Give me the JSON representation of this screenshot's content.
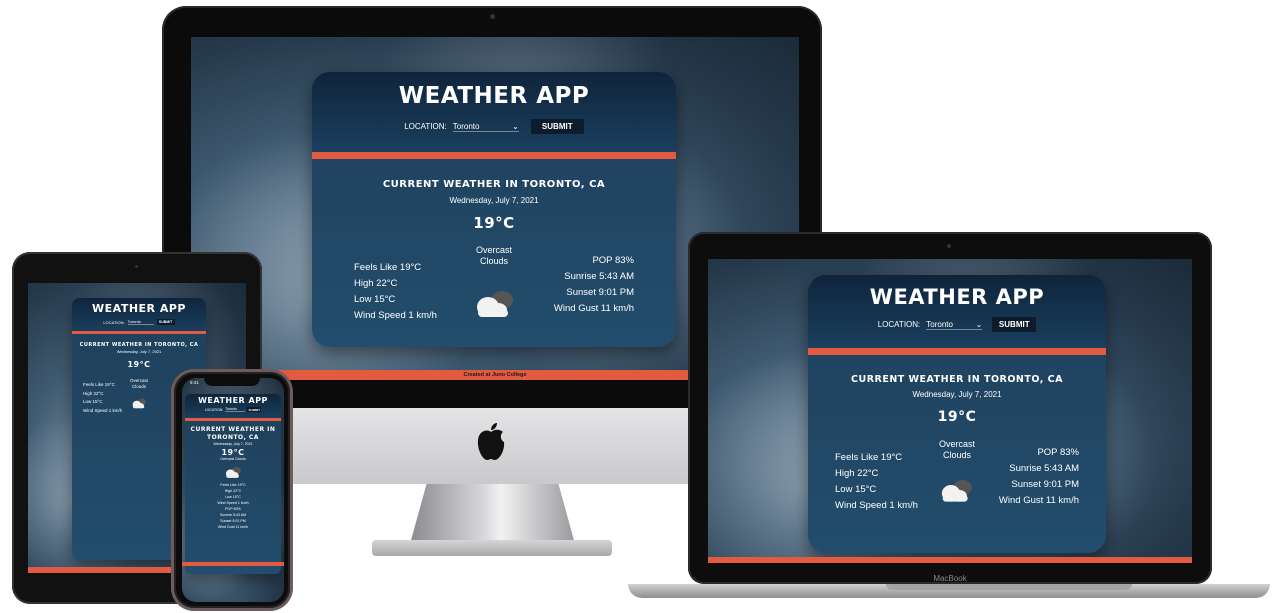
{
  "app": {
    "title": "WEATHER APP",
    "location_label": "LOCATION:",
    "location_value": "Toronto",
    "submit_label": "SUBMIT",
    "heading": "CURRENT WEATHER IN TORONTO, CA",
    "heading_line1": "CURRENT WEATHER IN",
    "heading_line2": "TORONTO, CA",
    "date": "Wednesday, July 7, 2021",
    "temperature": "19°C",
    "condition": "Overcast Clouds",
    "condition_line1": "Overcast",
    "condition_line2": "Clouds",
    "left_stats": [
      "Feels Like 19°C",
      "High 22°C",
      "Low 15°C",
      "Wind Speed 1 km/h"
    ],
    "right_stats": [
      "POP 83%",
      "Sunrise 5:43 AM",
      "Sunset 9:01 PM",
      "Wind Gust 11 km/h"
    ],
    "footer": "Created at Juno College",
    "weather_icon": "cloud-icon"
  },
  "devices": {
    "laptop_brand": "MacBook",
    "phone_time": "9:41"
  },
  "colors": {
    "accent": "#e25a3f",
    "card_dark": "#142c45",
    "button": "#0d1c2c"
  }
}
